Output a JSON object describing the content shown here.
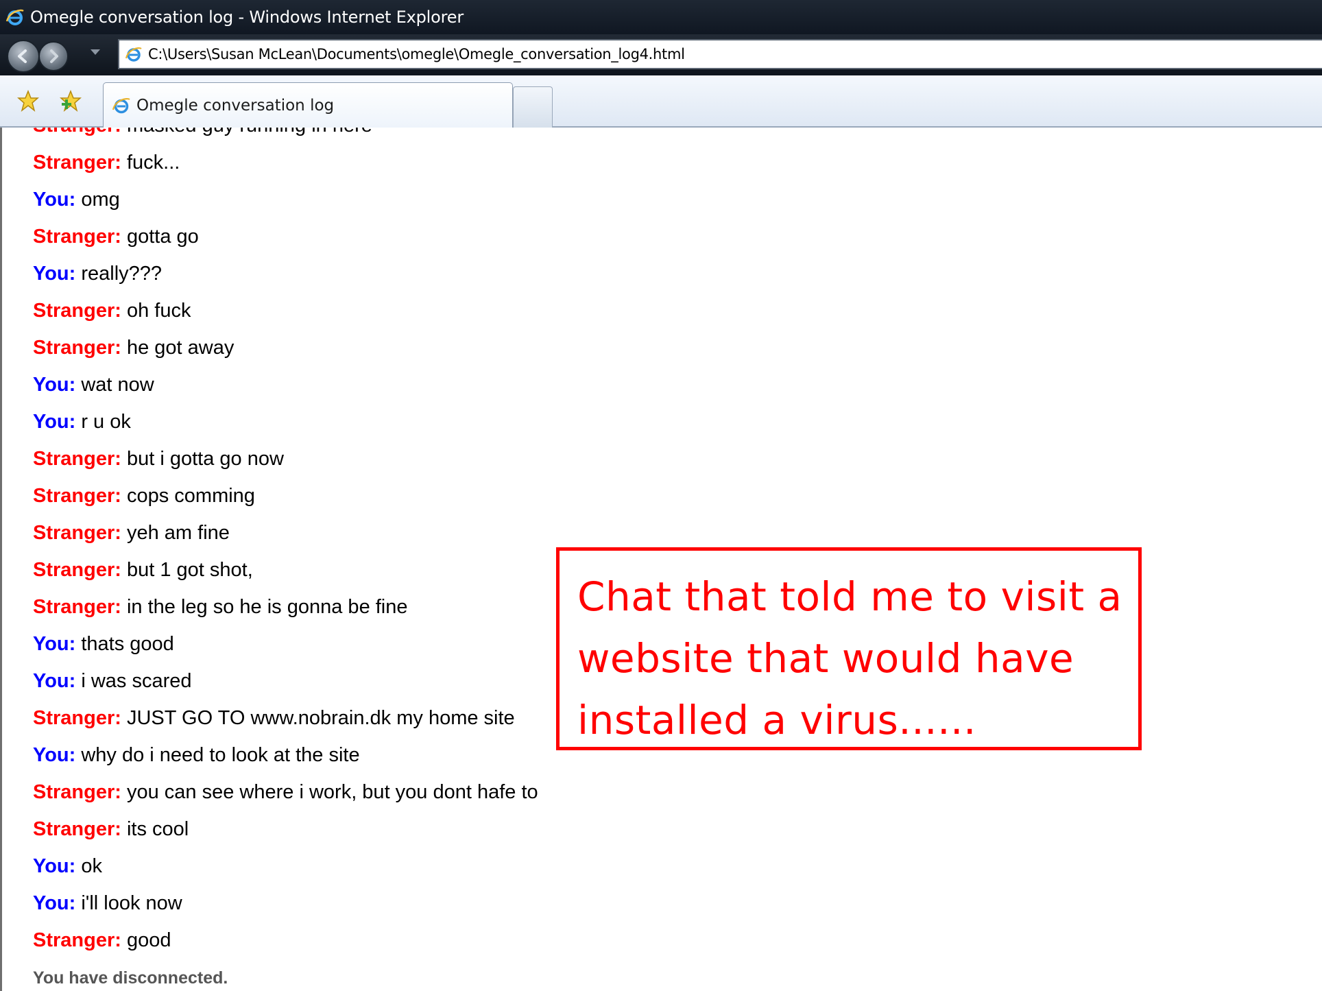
{
  "window": {
    "title": "Omegle conversation log - Windows Internet Explorer",
    "accent_titlebar": "#131b26"
  },
  "address_bar": {
    "url": "C:\\Users\\Susan McLean\\Documents\\omegle\\Omegle_conversation_log4.html"
  },
  "tabs": [
    {
      "label": "Omegle conversation log",
      "active": true
    }
  ],
  "icons": {
    "title": "ie-logo-icon",
    "back": "back-arrow-icon",
    "forward": "forward-arrow-icon",
    "favorites": "favorites-star-icon",
    "add_favorite": "add-favorite-icon",
    "page": "ie-page-icon"
  },
  "colors": {
    "stranger": "#ff0000",
    "you": "#0000ff",
    "annotation": "#ff0000"
  },
  "chat": {
    "messages": [
      {
        "speaker": "Stranger:",
        "role": "stranger",
        "text": " masked guy running in here"
      },
      {
        "speaker": "Stranger:",
        "role": "stranger",
        "text": " fuck..."
      },
      {
        "speaker": "You:",
        "role": "you",
        "text": " omg"
      },
      {
        "speaker": "Stranger:",
        "role": "stranger",
        "text": " gotta go"
      },
      {
        "speaker": "You:",
        "role": "you",
        "text": " really???"
      },
      {
        "speaker": "Stranger:",
        "role": "stranger",
        "text": " oh fuck"
      },
      {
        "speaker": "Stranger:",
        "role": "stranger",
        "text": " he got away"
      },
      {
        "speaker": "You:",
        "role": "you",
        "text": " wat now"
      },
      {
        "speaker": "You:",
        "role": "you",
        "text": " r u ok"
      },
      {
        "speaker": "Stranger:",
        "role": "stranger",
        "text": " but i gotta go now"
      },
      {
        "speaker": "Stranger:",
        "role": "stranger",
        "text": " cops comming"
      },
      {
        "speaker": "Stranger:",
        "role": "stranger",
        "text": " yeh am fine"
      },
      {
        "speaker": "Stranger:",
        "role": "stranger",
        "text": " but 1 got shot,"
      },
      {
        "speaker": "Stranger:",
        "role": "stranger",
        "text": " in the leg so he is gonna be fine"
      },
      {
        "speaker": "You:",
        "role": "you",
        "text": " thats good"
      },
      {
        "speaker": "You:",
        "role": "you",
        "text": " i was scared"
      },
      {
        "speaker": "Stranger:",
        "role": "stranger",
        "text": " JUST GO TO www.nobrain.dk my home site"
      },
      {
        "speaker": "You:",
        "role": "you",
        "text": " why do i need to look at the site"
      },
      {
        "speaker": "Stranger:",
        "role": "stranger",
        "text": " you can see where i work, but you dont hafe to"
      },
      {
        "speaker": "Stranger:",
        "role": "stranger",
        "text": " its cool"
      },
      {
        "speaker": "You:",
        "role": "you",
        "text": " ok"
      },
      {
        "speaker": "You:",
        "role": "you",
        "text": " i'll look now"
      },
      {
        "speaker": "Stranger:",
        "role": "stranger",
        "text": " good"
      }
    ],
    "status": "You have disconnected."
  },
  "annotation": {
    "text": "Chat that told me to visit a website that would have installed a virus......"
  }
}
